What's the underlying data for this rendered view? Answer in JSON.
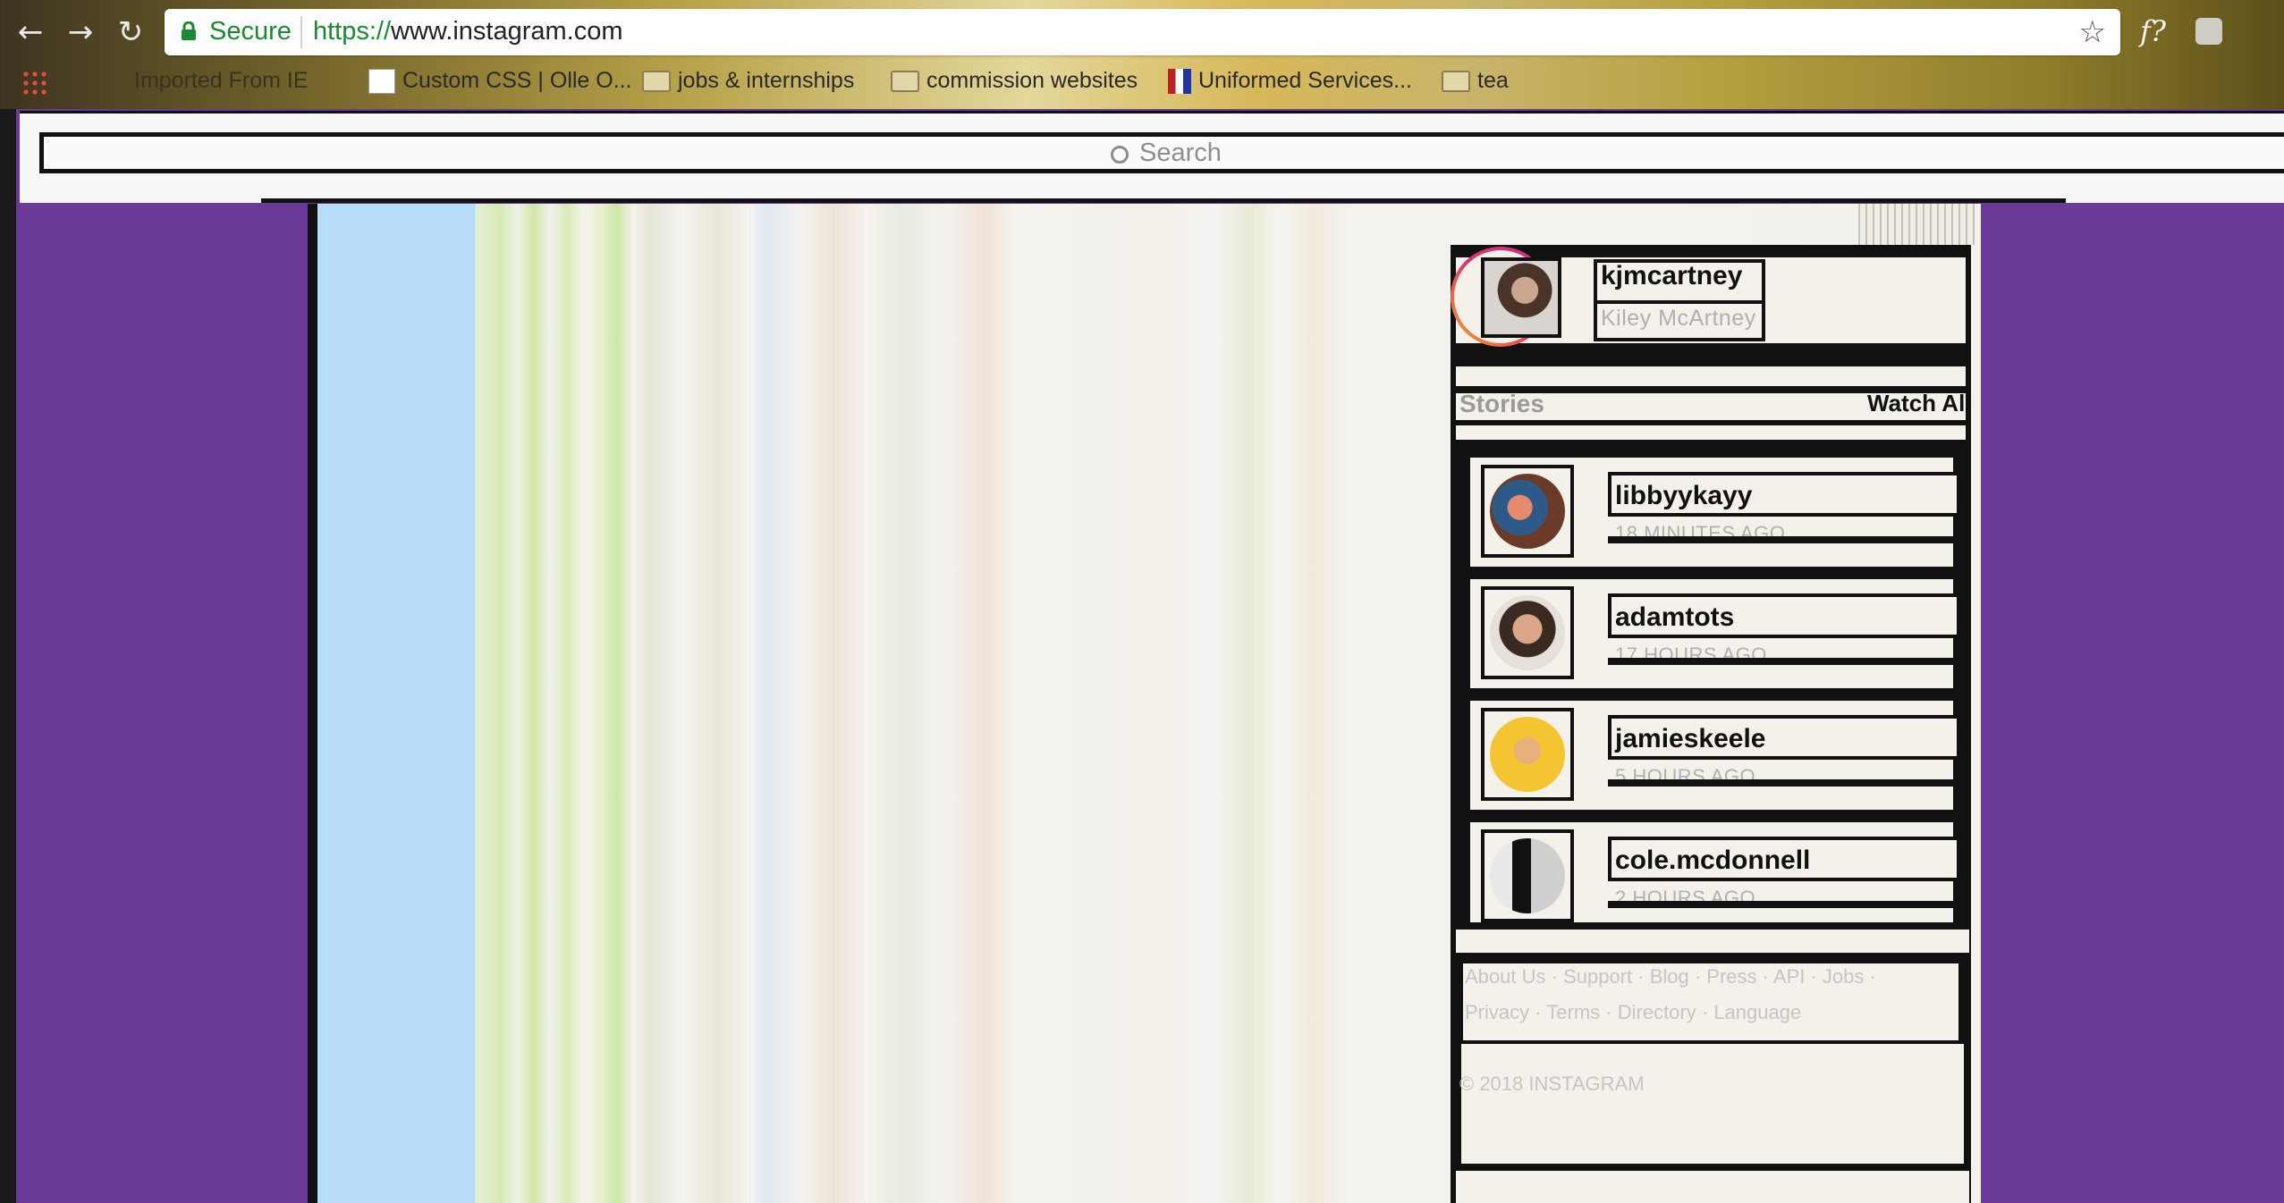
{
  "browser": {
    "secure_label": "Secure",
    "url_proto": "https://",
    "url_host": "www.instagram.com",
    "extension_label": "f?",
    "bookmarks": [
      {
        "label": "Imported From IE"
      },
      {
        "label": "Custom CSS | Olle O..."
      },
      {
        "label": "jobs & internships"
      },
      {
        "label": "commission websites"
      },
      {
        "label": "Uniformed Services..."
      },
      {
        "label": "tea"
      }
    ]
  },
  "search": {
    "placeholder": "Search"
  },
  "profile": {
    "username": "kjmcartney",
    "full_name": "Kiley McArtney"
  },
  "stories": {
    "title": "Stories",
    "watch_all": "Watch All",
    "items": [
      {
        "username": "libbyykayy",
        "time": "18 MINUTES AGO"
      },
      {
        "username": "adamtots",
        "time": "17 HOURS AGO"
      },
      {
        "username": "jamieskeele",
        "time": "5 HOURS AGO"
      },
      {
        "username": "cole.mcdonnell",
        "time": "2 HOURS AGO"
      }
    ]
  },
  "footer": {
    "links_row1": [
      "About Us",
      "Support",
      "Blog",
      "Press",
      "API",
      "Jobs"
    ],
    "links_row2": [
      "Privacy",
      "Terms",
      "Directory",
      "Language"
    ],
    "separator": " · ",
    "copyright": "© 2018 INSTAGRAM"
  },
  "colors": {
    "page_bg": "#6a3a99",
    "secure_green": "#1b8a34",
    "story_ring_start": "#f5a623",
    "story_ring_end": "#c13584"
  }
}
